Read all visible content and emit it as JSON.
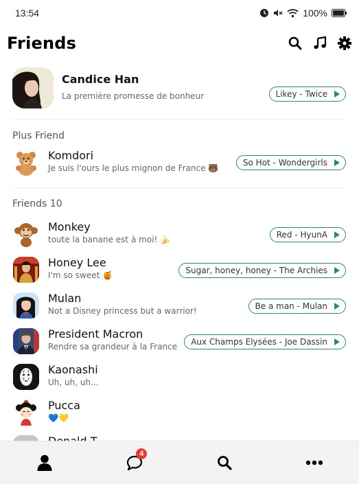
{
  "status_bar": {
    "time": "13:54",
    "battery": "100%"
  },
  "header": {
    "title": "Friends"
  },
  "profile": {
    "name": "Candice Han",
    "status": "La première promesse de bonheur",
    "music": "Likey - Twice"
  },
  "plus_friend": {
    "section_label": "Plus Friend",
    "name": "Komdori",
    "status": "Je suis l'ours le plus mignon de France 🐻",
    "music": "So Hot - Wondergirls"
  },
  "friends": {
    "section_label": "Friends 10",
    "items": [
      {
        "name": "Monkey",
        "status": "toute la banane est à moi! 🍌",
        "music": "Red - HyunA"
      },
      {
        "name": "Honey Lee",
        "status": "I'm so sweet 🍯",
        "music": "Sugar, honey, honey - The Archies"
      },
      {
        "name": "Mulan",
        "status": "Not a Disney princess but a warrior!",
        "music": "Be a man - Mulan"
      },
      {
        "name": "President Macron",
        "status": "Rendre sa grandeur à la France",
        "music": "Aux Champs Elysées - Joe Dassin"
      },
      {
        "name": "Kaonashi",
        "status": "Uh, uh, uh...",
        "music": ""
      },
      {
        "name": "Pucca",
        "status": "💙💛",
        "music": ""
      },
      {
        "name": "Donald T",
        "status": "",
        "music": ""
      }
    ]
  },
  "bottom_nav": {
    "items": [
      {
        "icon": "person-icon"
      },
      {
        "icon": "chat-icon",
        "badge": "4"
      },
      {
        "icon": "search-icon"
      },
      {
        "icon": "more-icon"
      }
    ]
  },
  "colors": {
    "accent": "#2e8b57",
    "badge": "#e53935"
  }
}
